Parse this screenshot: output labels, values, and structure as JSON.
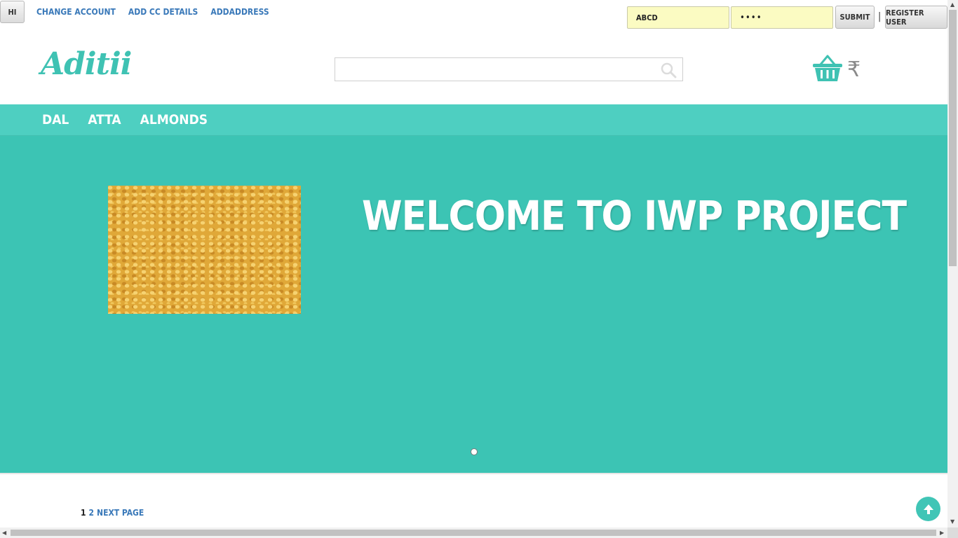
{
  "topbar": {
    "hi_label": "HI",
    "links": [
      "CHANGE ACCOUNT",
      "ADD CC DETAILS",
      "ADDADDRESS"
    ],
    "username_value": "ABCD",
    "password_value": "••••",
    "submit_label": "SUBMIT",
    "separator": "|",
    "register_label": "REGISTER USER"
  },
  "header": {
    "logo": "Aditii",
    "search_placeholder": "",
    "currency_symbol": "₹"
  },
  "nav": {
    "items": [
      "DAL",
      "ATTA",
      "ALMONDS"
    ]
  },
  "hero": {
    "title": "WELCOME TO IWP PROJECT",
    "image_alt": "dal"
  },
  "pagination": {
    "current": "1",
    "page2": "2",
    "next": "NEXT PAGE"
  },
  "colors": {
    "accent": "#3cc4b4",
    "nav": "#4ecfc1",
    "link": "#3a79b9",
    "input_bg": "#fbfbc2"
  },
  "icons": {
    "search": "search-icon",
    "basket": "basket-icon",
    "back_to_top": "arrow-up-icon"
  }
}
